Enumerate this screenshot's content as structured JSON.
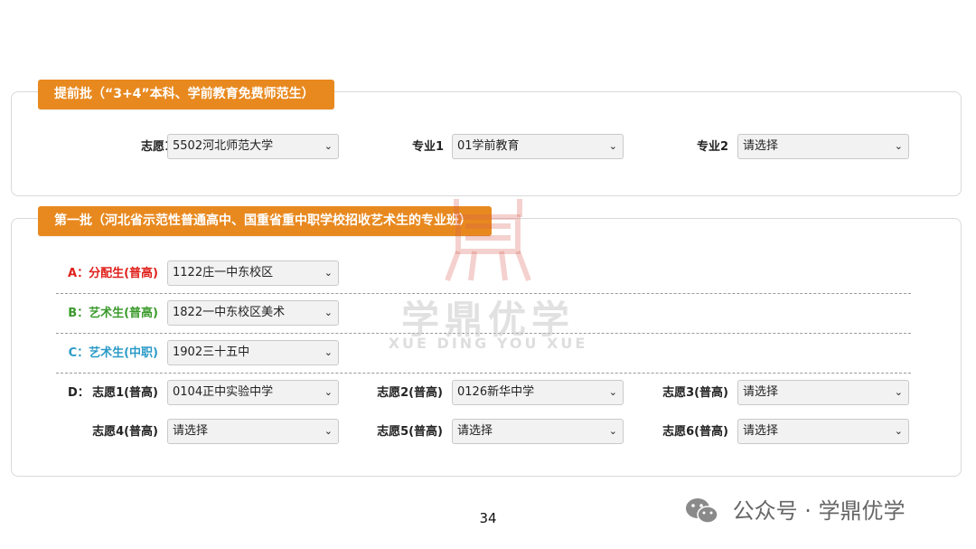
{
  "panel_early": {
    "title": "提前批（“3+4”本科、学前教育免费师范生）",
    "zhiyuan1_label": "志愿1",
    "zhiyuan1_value": "5502河北师范大学",
    "zhuanye1_label": "专业1",
    "zhuanye1_value": "01学前教育",
    "zhuanye2_label": "专业2",
    "zhuanye2_value": "请选择"
  },
  "panel_first": {
    "title": "第一批（河北省示范性普通高中、国重省重中职学校招收艺术生的专业班）",
    "a_label": "A：分配生(普高)",
    "a_value": "1122庄一中东校区",
    "b_label": "B：艺术生(普高)",
    "b_value": "1822一中东校区美术",
    "c_label": "C：艺术生(中职)",
    "c_value": "1902三十五中",
    "d_prefix": "D：",
    "d_items": [
      {
        "label": "志愿1(普高)",
        "value": "0104正中实验中学"
      },
      {
        "label": "志愿2(普高)",
        "value": "0126新华中学"
      },
      {
        "label": "志愿3(普高)",
        "value": "请选择"
      },
      {
        "label": "志愿4(普高)",
        "value": "请选择"
      },
      {
        "label": "志愿5(普高)",
        "value": "请选择"
      },
      {
        "label": "志愿6(普高)",
        "value": "请选择"
      }
    ]
  },
  "watermark": {
    "cn": "学鼎优学",
    "en": "XUE DING YOU XUE"
  },
  "page_number": "34",
  "footer": {
    "brand": "公众号 · 学鼎优学",
    "icon": "wechat-icon"
  },
  "colors": {
    "accent": "#e8891f",
    "a_label": "#e0201b",
    "b_label": "#3a9a2b",
    "c_label": "#2b9bc6"
  }
}
